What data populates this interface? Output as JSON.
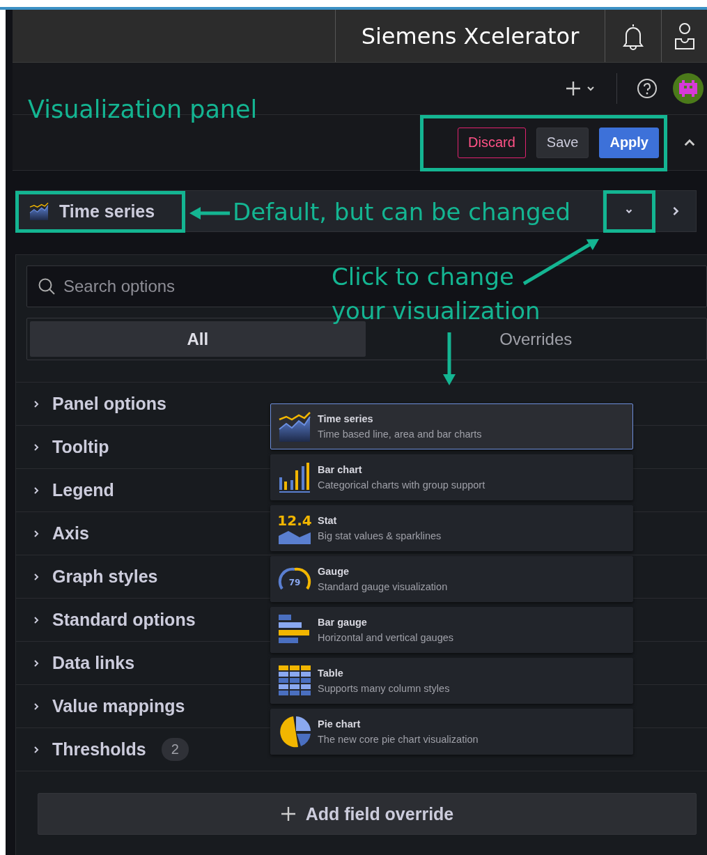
{
  "header": {
    "title": "Siemens Xcelerator"
  },
  "toolbar": {
    "buttons": [
      {
        "label": "Discard",
        "kind": "danger"
      },
      {
        "label": "Save",
        "kind": "secondary"
      },
      {
        "label": "Apply",
        "kind": "primary"
      }
    ]
  },
  "picker": {
    "label": "Time series"
  },
  "options": {
    "search": {
      "placeholder": "Search options"
    },
    "tabs": [
      {
        "label": "All",
        "selected": true
      },
      {
        "label": "Overrides",
        "selected": false
      }
    ],
    "sections": [
      {
        "label": "Panel options",
        "expanded": false
      },
      {
        "label": "Tooltip",
        "expanded": false
      },
      {
        "label": "Legend",
        "expanded": false
      },
      {
        "label": "Axis",
        "expanded": false
      },
      {
        "label": "Graph styles",
        "expanded": false
      },
      {
        "label": "Standard options",
        "expanded": false
      },
      {
        "label": "Data links",
        "expanded": false
      },
      {
        "label": "Value mappings",
        "expanded": false
      },
      {
        "label": "Thresholds",
        "expanded": false,
        "count": "2"
      }
    ],
    "add_button": {
      "label": "Add field override"
    }
  },
  "menu": [
    {
      "kind": "timeseries",
      "name": "Time series",
      "description": "Time based line, area and bar charts",
      "selected": true
    },
    {
      "kind": "barchart",
      "name": "Bar chart",
      "description": "Categorical charts with group support",
      "selected": false
    },
    {
      "kind": "stat",
      "name": "Stat",
      "description": "Big stat values & sparklines",
      "selected": false,
      "icon_text": "12.4"
    },
    {
      "kind": "gauge",
      "name": "Gauge",
      "description": "Standard gauge visualization",
      "selected": false,
      "icon_text": "79"
    },
    {
      "kind": "bargauge",
      "name": "Bar gauge",
      "description": "Horizontal and vertical gauges",
      "selected": false
    },
    {
      "kind": "table",
      "name": "Table",
      "description": "Supports many column styles",
      "selected": false
    },
    {
      "kind": "pie",
      "name": "Pie chart",
      "description": "The new core pie chart visualization",
      "selected": false
    }
  ],
  "annotations": [
    {
      "kind": "label",
      "text": "Visualization panel"
    },
    {
      "kind": "box"
    },
    {
      "kind": "box"
    },
    {
      "kind": "arrow"
    },
    {
      "kind": "label",
      "text": "Default, but can be changed"
    },
    {
      "kind": "box"
    },
    {
      "kind": "arrow"
    },
    {
      "kind": "label",
      "text": "Click to change"
    },
    {
      "kind": "label",
      "text": "your visualization"
    },
    {
      "kind": "arrow"
    }
  ]
}
